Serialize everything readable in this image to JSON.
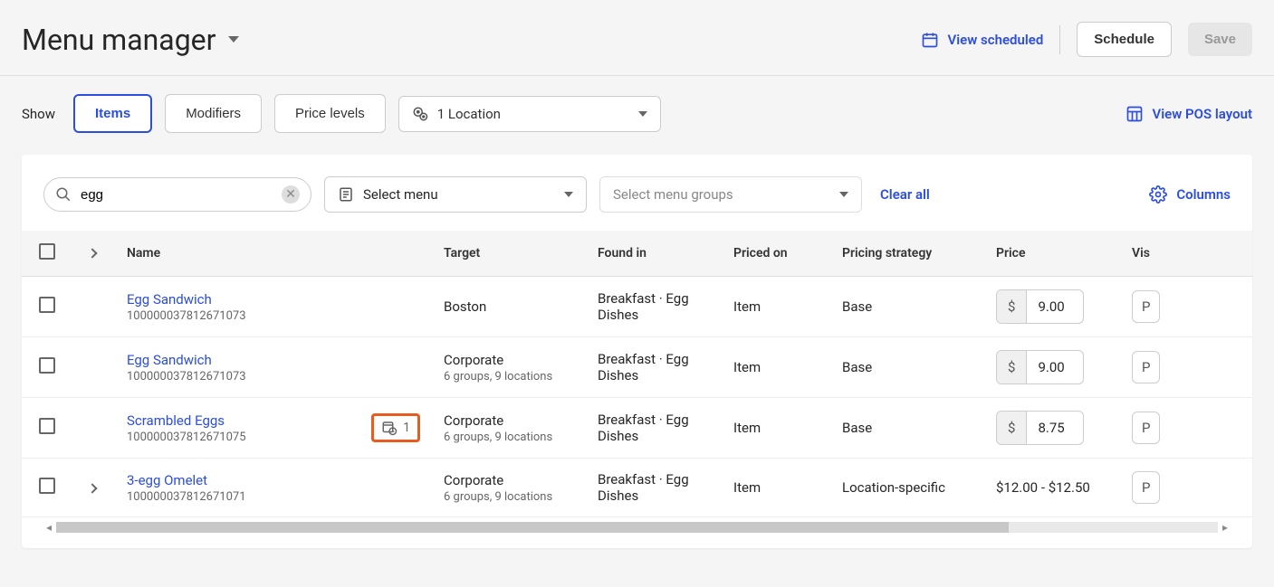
{
  "header": {
    "title": "Menu manager",
    "view_scheduled": "View scheduled",
    "schedule_btn": "Schedule",
    "save_btn": "Save"
  },
  "filters": {
    "show_label": "Show",
    "tabs": {
      "items": "Items",
      "modifiers": "Modifiers",
      "price_levels": "Price levels"
    },
    "location": "1 Location",
    "view_pos": "View POS layout"
  },
  "toolbar": {
    "search_value": "egg",
    "select_menu": "Select menu",
    "select_groups_placeholder": "Select menu groups",
    "clear_all": "Clear all",
    "columns": "Columns"
  },
  "columns": {
    "name": "Name",
    "target": "Target",
    "found_in": "Found in",
    "priced_on": "Priced on",
    "pricing_strategy": "Pricing strategy",
    "price": "Price",
    "visibility": "Vis"
  },
  "rows": [
    {
      "expandable": false,
      "name": "Egg Sandwich",
      "id": "100000037812671073",
      "target": "Boston",
      "target_sub": "",
      "found_in": "Breakfast · Egg Dishes",
      "priced_on": "Item",
      "strategy": "Base",
      "price_display": "input",
      "price": "9.00",
      "scheduled_badge": "",
      "vis": "P"
    },
    {
      "expandable": false,
      "name": "Egg Sandwich",
      "id": "100000037812671073",
      "target": "Corporate",
      "target_sub": "6 groups, 9 locations",
      "found_in": "Breakfast · Egg Dishes",
      "priced_on": "Item",
      "strategy": "Base",
      "price_display": "input",
      "price": "9.00",
      "scheduled_badge": "",
      "vis": "P"
    },
    {
      "expandable": false,
      "name": "Scrambled Eggs",
      "id": "100000037812671075",
      "target": "Corporate",
      "target_sub": "6 groups, 9 locations",
      "found_in": "Breakfast · Egg Dishes",
      "priced_on": "Item",
      "strategy": "Base",
      "price_display": "input",
      "price": "8.75",
      "scheduled_badge": "1",
      "vis": "P"
    },
    {
      "expandable": true,
      "name": "3-egg Omelet",
      "id": "100000037812671071",
      "target": "Corporate",
      "target_sub": "6 groups, 9 locations",
      "found_in": "Breakfast · Egg Dishes",
      "priced_on": "Item",
      "strategy": "Location-specific",
      "price_display": "text",
      "price": "$12.00 - $12.50",
      "scheduled_badge": "",
      "vis": "P"
    }
  ],
  "currency": "$"
}
